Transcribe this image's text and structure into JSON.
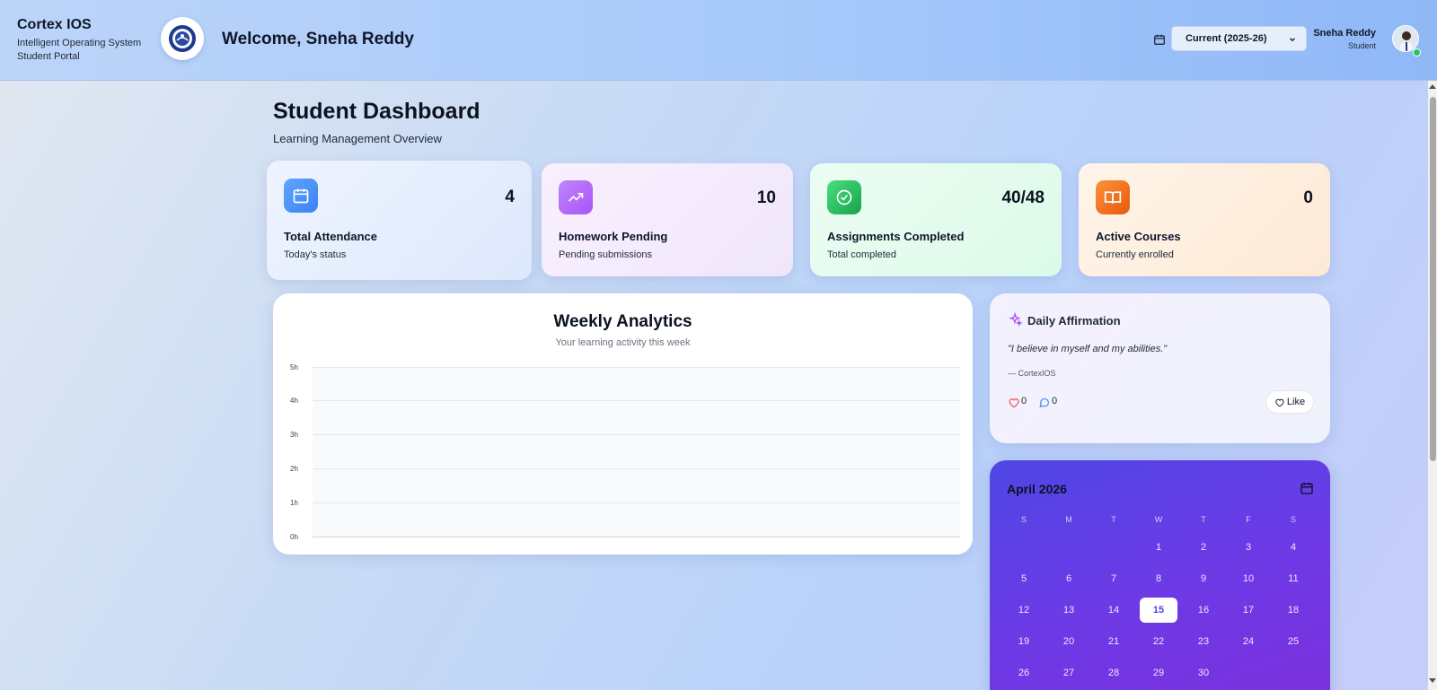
{
  "header": {
    "brand_name": "Cortex IOS",
    "brand_line1": "Intelligent Operating System",
    "brand_line2": "Student Portal",
    "welcome": "Welcome, Sneha Reddy",
    "year_select": "Current (2025-26)",
    "user_name": "Sneha Reddy",
    "user_role": "Student"
  },
  "page": {
    "title": "Student Dashboard",
    "subtitle": "Learning Management Overview"
  },
  "stats": [
    {
      "label": "Total Attendance",
      "value": "4",
      "sub": "Today's status",
      "icon": "calendar-icon",
      "color": "#3b82f6"
    },
    {
      "label": "Homework Pending",
      "value": "10",
      "sub": "Pending submissions",
      "icon": "trending-up-icon",
      "color": "#a855f7"
    },
    {
      "label": "Assignments Completed",
      "value": "40/48",
      "sub": "Total completed",
      "icon": "check-circle-icon",
      "color": "#22c55e"
    },
    {
      "label": "Active Courses",
      "value": "0",
      "sub": "Currently enrolled",
      "icon": "book-open-icon",
      "color": "#f97316"
    }
  ],
  "analytics": {
    "title": "Weekly Analytics",
    "subtitle": "Your learning activity this week",
    "y_ticks": [
      "5h",
      "4h",
      "3h",
      "2h",
      "1h",
      "0h"
    ]
  },
  "affirmation": {
    "title": "Daily Affirmation",
    "quote": "\"I believe in myself and my abilities.\"",
    "author": "— CortexIOS",
    "likes": "0",
    "comments": "0",
    "like_label": "Like"
  },
  "calendar": {
    "month": "April 2026",
    "weekdays": [
      "S",
      "M",
      "T",
      "W",
      "T",
      "F",
      "S"
    ],
    "today": 15,
    "days": [
      "1",
      "2",
      "3",
      "4",
      "5",
      "6",
      "7",
      "8",
      "9",
      "10",
      "11",
      "12",
      "13",
      "14",
      "15",
      "16",
      "17",
      "18",
      "19",
      "20",
      "21",
      "22",
      "23",
      "24",
      "25",
      "26",
      "27",
      "28",
      "29",
      "30"
    ]
  }
}
